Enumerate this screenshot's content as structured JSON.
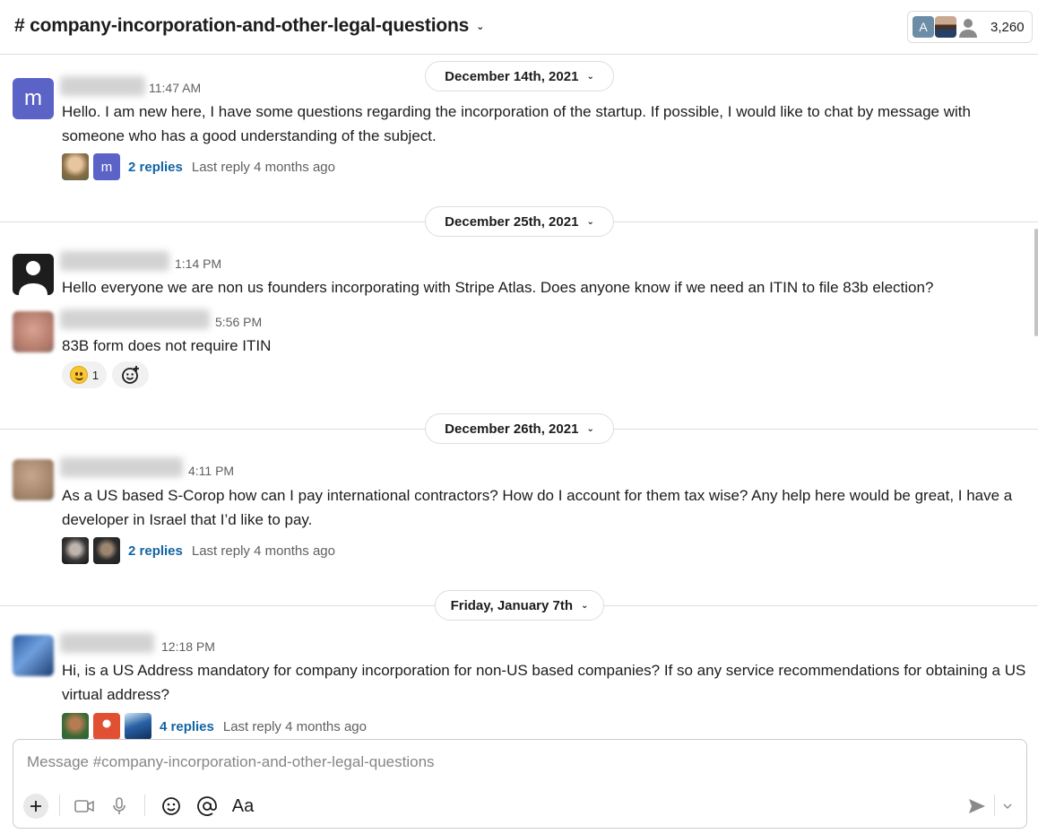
{
  "header": {
    "channel_name": "# company-incorporation-and-other-legal-questions",
    "chevron": "chevron-down-icon",
    "member_avatar_letter": "A",
    "member_count": "3,260"
  },
  "dates": {
    "d1": "December 14th, 2021",
    "d2": "December 25th, 2021",
    "d3": "December 26th, 2021",
    "d4": "Friday, January 7th"
  },
  "messages": [
    {
      "avatar_letter": "m",
      "time": "11:47 AM",
      "text": "Hello.  I am new here, I have some questions regarding the incorporation of the startup.  If possible, I would like to chat by message with someone who has a good understanding of the subject.",
      "thread_avatar_letter": "m",
      "replies": "2 replies",
      "last_reply": "Last reply 4 months ago"
    },
    {
      "time": "1:14 PM",
      "text": "Hello everyone we are non us founders incorporating with Stripe Atlas. Does anyone know if we need an ITIN to file 83b election?"
    },
    {
      "time": "5:56 PM",
      "text": "83B form does not  require ITIN",
      "reaction_count": "1"
    },
    {
      "time": "4:11 PM",
      "text": "As a US based S-Corop how can I pay international contractors? How do I account for them tax wise? Any help here would be great, I have a developer in Israel that I’d like to pay.",
      "replies": "2 replies",
      "last_reply": "Last reply 4 months ago"
    },
    {
      "time": "12:18 PM",
      "text": "Hi, is a US Address mandatory for company incorporation for non-US based companies? If so any service recommendations for obtaining a US virtual address?",
      "replies": "4 replies",
      "last_reply": "Last reply 4 months ago"
    }
  ],
  "composer": {
    "placeholder": "Message #company-incorporation-and-other-legal-questions",
    "format_label": "Aa"
  },
  "colors": {
    "link": "#1264a3",
    "avatar_purple": "#5c63c7",
    "muted_text": "#616061",
    "border": "#dddddd"
  }
}
